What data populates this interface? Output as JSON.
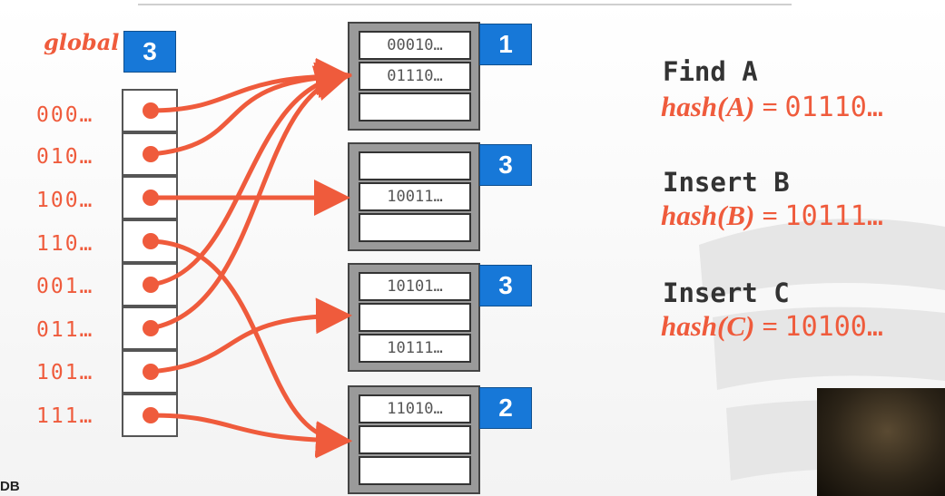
{
  "global": {
    "label": "global",
    "depth": "3"
  },
  "directory": [
    {
      "label": "000…"
    },
    {
      "label": "010…"
    },
    {
      "label": "100…"
    },
    {
      "label": "110…"
    },
    {
      "label": "001…"
    },
    {
      "label": "011…"
    },
    {
      "label": "101…"
    },
    {
      "label": "111…"
    }
  ],
  "buckets": [
    {
      "local_depth": "1",
      "slots": [
        "00010…",
        "01110…",
        ""
      ]
    },
    {
      "local_depth": "3",
      "slots": [
        "",
        "10011…",
        ""
      ]
    },
    {
      "local_depth": "3",
      "slots": [
        "10101…",
        "",
        "10111…"
      ]
    },
    {
      "local_depth": "2",
      "slots": [
        "11010…",
        "",
        ""
      ]
    }
  ],
  "pointers": [
    0,
    0,
    1,
    3,
    0,
    0,
    2,
    3
  ],
  "operations": [
    {
      "title": "Find A",
      "fn": "hash(A)",
      "eq": " = ",
      "value": "01110…"
    },
    {
      "title": "Insert B",
      "fn": "hash(B)",
      "eq": " = ",
      "value": "10111…"
    },
    {
      "title": "Insert C",
      "fn": "hash(C)",
      "eq": " = ",
      "value": "10100…"
    }
  ],
  "footer": {
    "text": "DB"
  },
  "colors": {
    "accent": "#ef5b3c",
    "depth_box": "#1778d8",
    "bucket_fill": "#9a9a9a"
  }
}
